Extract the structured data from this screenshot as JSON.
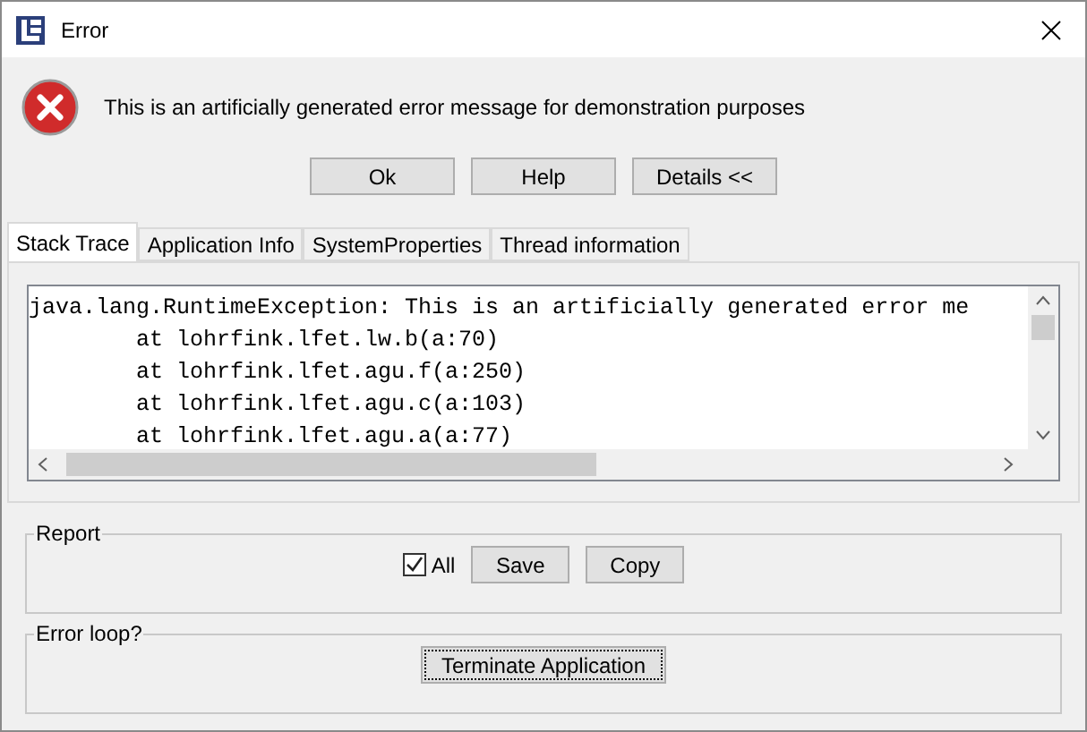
{
  "window": {
    "title": "Error"
  },
  "message": "This is an artificially generated error message for demonstration purposes",
  "buttons": [
    "Ok",
    "Help",
    "Details <<"
  ],
  "tabs": [
    {
      "label": "Stack Trace",
      "selected": true
    },
    {
      "label": "Application Info",
      "selected": false
    },
    {
      "label": "SystemProperties",
      "selected": false
    },
    {
      "label": "Thread information",
      "selected": false
    }
  ],
  "stack_trace": {
    "exception": "java.lang.RuntimeException: This is an artificially generated error me",
    "frames": [
      "at lohrfink.lfet.lw.b(a:70)",
      "at lohrfink.lfet.agu.f(a:250)",
      "at lohrfink.lfet.agu.c(a:103)",
      "at lohrfink.lfet.agu.a(a:77)"
    ]
  },
  "report": {
    "title": "Report",
    "checkbox": {
      "label": "All",
      "checked": true
    },
    "buttons": [
      "Save",
      "Copy"
    ]
  },
  "error_loop": {
    "title": "Error loop?",
    "button": {
      "label": "Terminate Application",
      "focused": true
    }
  }
}
